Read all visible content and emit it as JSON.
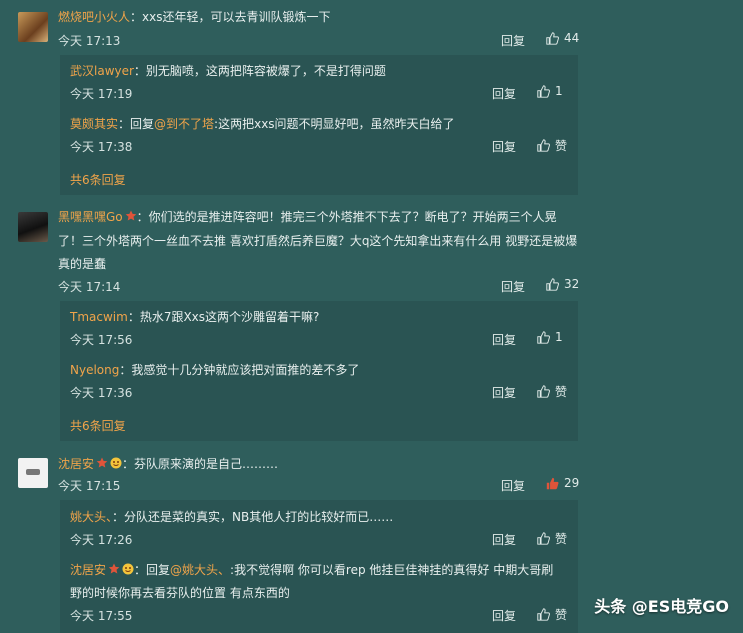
{
  "comments": [
    {
      "author": "燃烧吧小火人",
      "text": "：xxs还年轻，可以去青训队锻炼一下",
      "time": "今天 17:13",
      "reply_label": "回复",
      "likes": "44",
      "replies": [
        {
          "author": "武汉lawyer",
          "text": "：别无脑喷，这两把阵容被爆了，不是打得问题",
          "time": "今天 17:19",
          "reply_label": "回复",
          "likes": "1"
        },
        {
          "author": "莫颇其实",
          "text": "：回复",
          "mention": "@到不了塔",
          "text2": ":这两把xxs问题不明显好吧，虽然昨天白给了",
          "time": "今天 17:38",
          "reply_label": "回复",
          "likes": "赞"
        }
      ],
      "more": "共6条回复"
    },
    {
      "author": "黑嘿黑嘿Go",
      "line1": "：你们选的是推进阵容吧！推完三个外塔推不下去了？断电了？开始两三个人晃",
      "line2": "了！三个外塔两个一丝血不去推 喜欢打盾然后养巨魔？大q这个先知拿出来有什么用 视野还是被爆",
      "line3": "真的是蠢",
      "time": "今天 17:14",
      "reply_label": "回复",
      "likes": "32",
      "replies": [
        {
          "author": "Tmacwim",
          "text": "：热水7跟Xxs这两个沙雕留着干嘛?",
          "time": "今天 17:56",
          "reply_label": "回复",
          "likes": "1"
        },
        {
          "author": "Nyelong",
          "text": "：我感觉十几分钟就应该把对面推的差不多了",
          "time": "今天 17:36",
          "reply_label": "回复",
          "likes": "赞"
        }
      ],
      "more": "共6条回复"
    },
    {
      "author": "沈居安",
      "text": "：芬队原来演的是自己………",
      "time": "今天 17:15",
      "reply_label": "回复",
      "likes": "29",
      "replies": [
        {
          "author": "姚大头、",
          "text": "：分队还是菜的真实，NB其他人打的比较好而已……",
          "time": "今天 17:26",
          "reply_label": "回复",
          "likes": "赞"
        },
        {
          "author": "沈居安",
          "text": "：回复",
          "mention": "@姚大头、",
          "text2": ":我不觉得啊 你可以看rep 他挂巨佳神挂的真得好 中期大哥刷",
          "line2": "野的时候你再去看芬队的位置 有点东西的",
          "time": "今天 17:55",
          "reply_label": "回复",
          "likes": "赞"
        }
      ]
    }
  ],
  "watermark": "头条 @ES电竞GO",
  "colors": {
    "background": "#2f5e5c",
    "reply_box": "#2a5453",
    "name": "#f0a44a",
    "like_active": "#e0543a"
  }
}
